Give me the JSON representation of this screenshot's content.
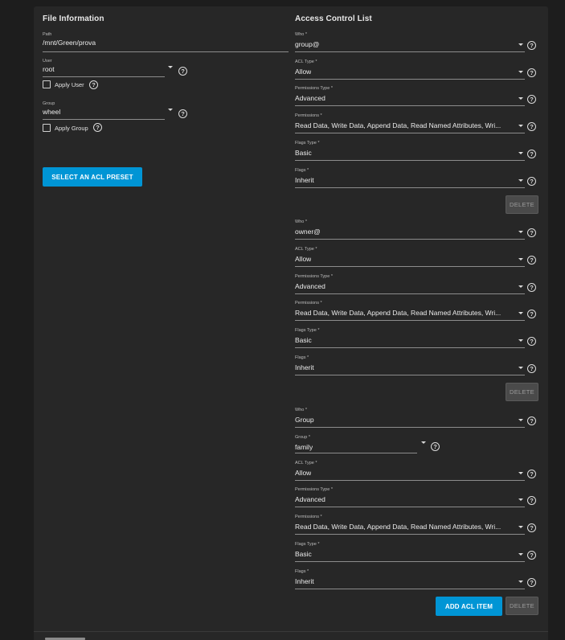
{
  "file_info": {
    "title": "File Information",
    "path": {
      "label": "Path",
      "value": "/mnt/Green/prova"
    },
    "user": {
      "label": "User",
      "value": "root"
    },
    "apply_user_label": "Apply User",
    "group": {
      "label": "Group",
      "value": "wheel"
    },
    "apply_group_label": "Apply Group",
    "preset_button": "SELECT AN ACL PRESET"
  },
  "acl": {
    "title": "Access Control List",
    "entries": [
      {
        "who": {
          "label": "Who *",
          "value": "group@"
        },
        "acl_type": {
          "label": "ACL Type *",
          "value": "Allow"
        },
        "permissions_type": {
          "label": "Permissions Type *",
          "value": "Advanced"
        },
        "permissions": {
          "label": "Permissions *",
          "value": "Read Data, Write Data, Append Data, Read Named Attributes, Wri..."
        },
        "flags_type": {
          "label": "Flags Type *",
          "value": "Basic"
        },
        "flags": {
          "label": "Flags *",
          "value": "Inherit"
        },
        "delete_label": "DELETE"
      },
      {
        "who": {
          "label": "Who *",
          "value": "owner@"
        },
        "acl_type": {
          "label": "ACL Type *",
          "value": "Allow"
        },
        "permissions_type": {
          "label": "Permissions Type *",
          "value": "Advanced"
        },
        "permissions": {
          "label": "Permissions *",
          "value": "Read Data, Write Data, Append Data, Read Named Attributes, Wri..."
        },
        "flags_type": {
          "label": "Flags Type *",
          "value": "Basic"
        },
        "flags": {
          "label": "Flags *",
          "value": "Inherit"
        },
        "delete_label": "DELETE"
      },
      {
        "who": {
          "label": "Who *",
          "value": "Group"
        },
        "group": {
          "label": "Group *",
          "value": "family"
        },
        "acl_type": {
          "label": "ACL Type *",
          "value": "Allow"
        },
        "permissions_type": {
          "label": "Permissions Type *",
          "value": "Advanced"
        },
        "permissions": {
          "label": "Permissions *",
          "value": "Read Data, Write Data, Append Data, Read Named Attributes, Wri..."
        },
        "flags_type": {
          "label": "Flags Type *",
          "value": "Basic"
        },
        "flags": {
          "label": "Flags *",
          "value": "Inherit"
        },
        "delete_label": "DELETE"
      }
    ],
    "add_button": "ADD ACL ITEM"
  },
  "icons": {
    "help": "help-circle-icon",
    "dropdown": "chevron-down-icon",
    "checkbox": "checkbox-icon"
  },
  "colors": {
    "background": "#1d1d1d",
    "card": "#272727",
    "primary": "#0095d5"
  }
}
